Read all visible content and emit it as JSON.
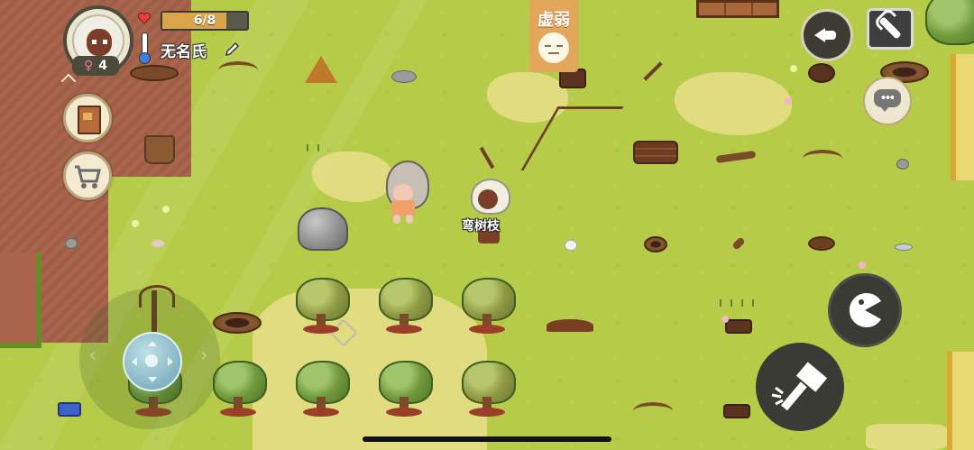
{
  "hud": {
    "health_text": "6/8",
    "health_fraction": 0.75,
    "player_name": "无名氏",
    "gender_symbol": "♀",
    "generation": "4",
    "icons": {
      "heart": "heart-icon",
      "thermometer": "thermometer-icon",
      "edit": "pencil-icon",
      "journal": "book-icon",
      "shop": "cart-icon"
    }
  },
  "status": {
    "label": "虚弱",
    "icon": "tired-face-icon"
  },
  "world": {
    "npc_label": "弯树枝"
  },
  "controls": {
    "back": "back-arrow-icon",
    "settings": "wrench-icon",
    "chat": "chat-bubble-icon",
    "eat": "eat-pacman-icon",
    "action": "hammer-icon",
    "joystick": "joystick"
  },
  "colors": {
    "grass": "#b6cb48",
    "dirt": "#a9644c",
    "sand": "#e7df8a",
    "status_tag": "#e4a65a",
    "health_fill": "#d8a54d"
  }
}
